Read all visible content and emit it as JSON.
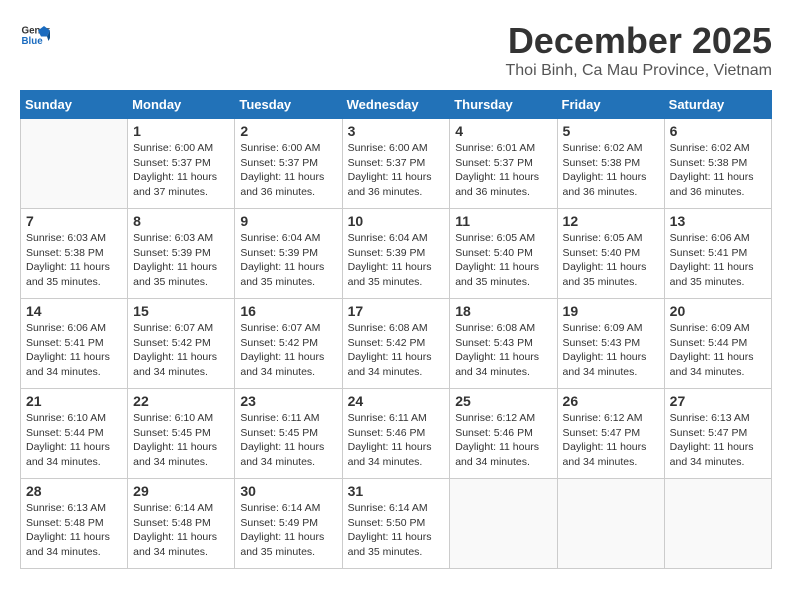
{
  "header": {
    "logo_general": "General",
    "logo_blue": "Blue",
    "month": "December 2025",
    "location": "Thoi Binh, Ca Mau Province, Vietnam"
  },
  "days_of_week": [
    "Sunday",
    "Monday",
    "Tuesday",
    "Wednesday",
    "Thursday",
    "Friday",
    "Saturday"
  ],
  "weeks": [
    [
      {
        "day": "",
        "info": ""
      },
      {
        "day": "1",
        "info": "Sunrise: 6:00 AM\nSunset: 5:37 PM\nDaylight: 11 hours\nand 37 minutes."
      },
      {
        "day": "2",
        "info": "Sunrise: 6:00 AM\nSunset: 5:37 PM\nDaylight: 11 hours\nand 36 minutes."
      },
      {
        "day": "3",
        "info": "Sunrise: 6:00 AM\nSunset: 5:37 PM\nDaylight: 11 hours\nand 36 minutes."
      },
      {
        "day": "4",
        "info": "Sunrise: 6:01 AM\nSunset: 5:37 PM\nDaylight: 11 hours\nand 36 minutes."
      },
      {
        "day": "5",
        "info": "Sunrise: 6:02 AM\nSunset: 5:38 PM\nDaylight: 11 hours\nand 36 minutes."
      },
      {
        "day": "6",
        "info": "Sunrise: 6:02 AM\nSunset: 5:38 PM\nDaylight: 11 hours\nand 36 minutes."
      }
    ],
    [
      {
        "day": "7",
        "info": "Sunrise: 6:03 AM\nSunset: 5:38 PM\nDaylight: 11 hours\nand 35 minutes."
      },
      {
        "day": "8",
        "info": "Sunrise: 6:03 AM\nSunset: 5:39 PM\nDaylight: 11 hours\nand 35 minutes."
      },
      {
        "day": "9",
        "info": "Sunrise: 6:04 AM\nSunset: 5:39 PM\nDaylight: 11 hours\nand 35 minutes."
      },
      {
        "day": "10",
        "info": "Sunrise: 6:04 AM\nSunset: 5:39 PM\nDaylight: 11 hours\nand 35 minutes."
      },
      {
        "day": "11",
        "info": "Sunrise: 6:05 AM\nSunset: 5:40 PM\nDaylight: 11 hours\nand 35 minutes."
      },
      {
        "day": "12",
        "info": "Sunrise: 6:05 AM\nSunset: 5:40 PM\nDaylight: 11 hours\nand 35 minutes."
      },
      {
        "day": "13",
        "info": "Sunrise: 6:06 AM\nSunset: 5:41 PM\nDaylight: 11 hours\nand 35 minutes."
      }
    ],
    [
      {
        "day": "14",
        "info": "Sunrise: 6:06 AM\nSunset: 5:41 PM\nDaylight: 11 hours\nand 34 minutes."
      },
      {
        "day": "15",
        "info": "Sunrise: 6:07 AM\nSunset: 5:42 PM\nDaylight: 11 hours\nand 34 minutes."
      },
      {
        "day": "16",
        "info": "Sunrise: 6:07 AM\nSunset: 5:42 PM\nDaylight: 11 hours\nand 34 minutes."
      },
      {
        "day": "17",
        "info": "Sunrise: 6:08 AM\nSunset: 5:42 PM\nDaylight: 11 hours\nand 34 minutes."
      },
      {
        "day": "18",
        "info": "Sunrise: 6:08 AM\nSunset: 5:43 PM\nDaylight: 11 hours\nand 34 minutes."
      },
      {
        "day": "19",
        "info": "Sunrise: 6:09 AM\nSunset: 5:43 PM\nDaylight: 11 hours\nand 34 minutes."
      },
      {
        "day": "20",
        "info": "Sunrise: 6:09 AM\nSunset: 5:44 PM\nDaylight: 11 hours\nand 34 minutes."
      }
    ],
    [
      {
        "day": "21",
        "info": "Sunrise: 6:10 AM\nSunset: 5:44 PM\nDaylight: 11 hours\nand 34 minutes."
      },
      {
        "day": "22",
        "info": "Sunrise: 6:10 AM\nSunset: 5:45 PM\nDaylight: 11 hours\nand 34 minutes."
      },
      {
        "day": "23",
        "info": "Sunrise: 6:11 AM\nSunset: 5:45 PM\nDaylight: 11 hours\nand 34 minutes."
      },
      {
        "day": "24",
        "info": "Sunrise: 6:11 AM\nSunset: 5:46 PM\nDaylight: 11 hours\nand 34 minutes."
      },
      {
        "day": "25",
        "info": "Sunrise: 6:12 AM\nSunset: 5:46 PM\nDaylight: 11 hours\nand 34 minutes."
      },
      {
        "day": "26",
        "info": "Sunrise: 6:12 AM\nSunset: 5:47 PM\nDaylight: 11 hours\nand 34 minutes."
      },
      {
        "day": "27",
        "info": "Sunrise: 6:13 AM\nSunset: 5:47 PM\nDaylight: 11 hours\nand 34 minutes."
      }
    ],
    [
      {
        "day": "28",
        "info": "Sunrise: 6:13 AM\nSunset: 5:48 PM\nDaylight: 11 hours\nand 34 minutes."
      },
      {
        "day": "29",
        "info": "Sunrise: 6:14 AM\nSunset: 5:48 PM\nDaylight: 11 hours\nand 34 minutes."
      },
      {
        "day": "30",
        "info": "Sunrise: 6:14 AM\nSunset: 5:49 PM\nDaylight: 11 hours\nand 35 minutes."
      },
      {
        "day": "31",
        "info": "Sunrise: 6:14 AM\nSunset: 5:50 PM\nDaylight: 11 hours\nand 35 minutes."
      },
      {
        "day": "",
        "info": ""
      },
      {
        "day": "",
        "info": ""
      },
      {
        "day": "",
        "info": ""
      }
    ]
  ]
}
